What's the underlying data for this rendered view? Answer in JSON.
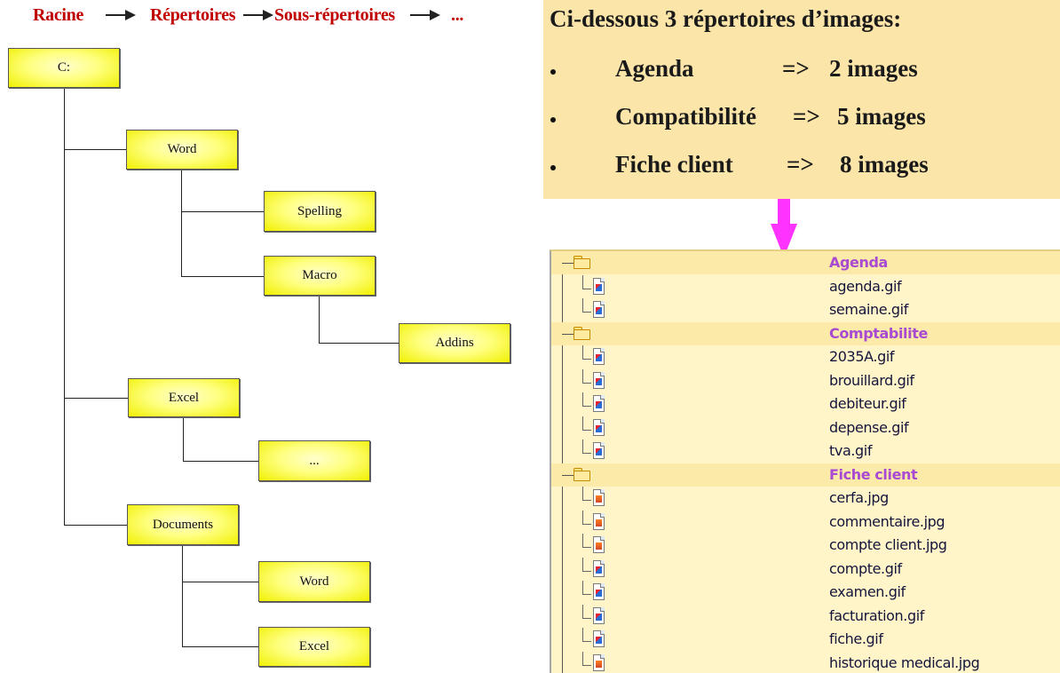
{
  "breadcrumb": {
    "root": "Racine",
    "level1": "Répertoires",
    "level2": "Sous-répertoires",
    "more": "..."
  },
  "tree": {
    "root": "C:",
    "word": "Word",
    "spelling": "Spelling",
    "macro": "Macro",
    "addins": "Addins",
    "excel": "Excel",
    "excel_child": "...",
    "documents": "Documents",
    "doc_word": "Word",
    "doc_excel": "Excel"
  },
  "info": {
    "title": "Ci-dessous 3 répertoires d’images:",
    "items": [
      {
        "name": "Agenda",
        "arrow": "=>",
        "count": "2 images"
      },
      {
        "name": "Compatibilité",
        "arrow": "=>",
        "count": "5 images"
      },
      {
        "name": "Fiche client",
        "arrow": "=>",
        "count": "8 images"
      }
    ]
  },
  "listing": {
    "rows": [
      {
        "type": "folder",
        "label": "Agenda"
      },
      {
        "type": "gif",
        "label": "agenda.gif"
      },
      {
        "type": "gif",
        "label": "semaine.gif"
      },
      {
        "type": "folder",
        "label": "Comptabilite"
      },
      {
        "type": "gif",
        "label": "2035A.gif"
      },
      {
        "type": "gif",
        "label": "brouillard.gif"
      },
      {
        "type": "gif",
        "label": "debiteur.gif"
      },
      {
        "type": "gif",
        "label": "depense.gif"
      },
      {
        "type": "gif",
        "label": "tva.gif"
      },
      {
        "type": "folder",
        "label": "Fiche client"
      },
      {
        "type": "jpg",
        "label": "cerfa.jpg"
      },
      {
        "type": "jpg",
        "label": "commentaire.jpg"
      },
      {
        "type": "jpg",
        "label": "compte client.jpg"
      },
      {
        "type": "gif",
        "label": "compte.gif"
      },
      {
        "type": "gif",
        "label": "examen.gif"
      },
      {
        "type": "gif",
        "label": "facturation.gif"
      },
      {
        "type": "gif",
        "label": "fiche.gif"
      },
      {
        "type": "jpg",
        "label": "historique medical.jpg"
      }
    ]
  },
  "colors": {
    "breadcrumb": "#c00000",
    "node_fill": "#ffff80",
    "info_bg": "#fce5a9",
    "arrow": "#ff33ff",
    "folder_label": "#a84ad2",
    "listing_bg": "#fff5c8"
  }
}
